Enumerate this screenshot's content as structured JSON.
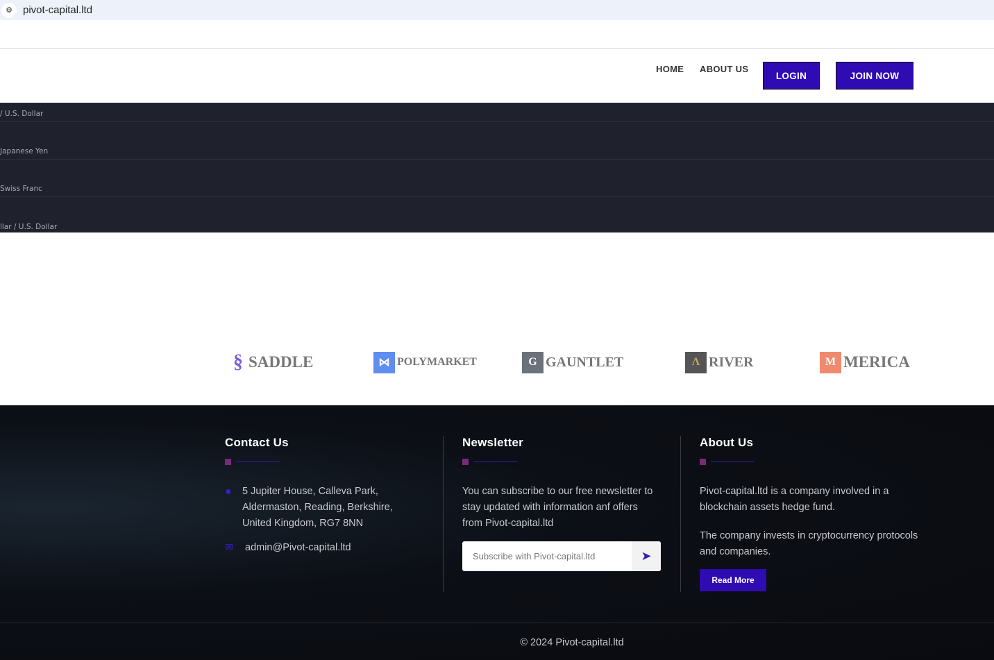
{
  "browser": {
    "url": "pivot-capital.ltd",
    "site_icon": "tune-icon"
  },
  "nav": {
    "home": "HOME",
    "about": "ABOUT US",
    "login": "LOGIN",
    "join": "JOIN NOW"
  },
  "ticker": [
    " / U.S. Dollar",
    "Japanese Yen",
    "Swiss Franc",
    "llar / U.S. Dollar"
  ],
  "partners": [
    "SADDLE",
    "POLYMARKET",
    "GAUNTLET",
    "RIVER",
    "MERICA"
  ],
  "footer": {
    "contact": {
      "title": "Contact Us",
      "address_lines": [
        "5 Jupiter House, Calleva Park,",
        "Aldermaston, Reading, Berkshire,",
        "United Kingdom, RG7 8NN"
      ],
      "email": "admin@Pivot-capital.ltd"
    },
    "newsletter": {
      "title": "Newsletter",
      "text_lines": [
        "You can subscribe to our free newsletter to",
        "stay updated with information anf offers",
        "from Pivot-capital.ltd"
      ],
      "placeholder": "Subscribe with Pivot-capital.ltd"
    },
    "about": {
      "title": "About Us",
      "p1_lines": [
        "Pivot-capital.ltd is a company involved in a",
        "blockchain assets hedge fund."
      ],
      "p2_lines": [
        "The company invests in cryptocurrency protocols",
        "and companies."
      ],
      "read_more": "Read More"
    },
    "copyright": "© 2024 Pivot-capital.ltd"
  },
  "colors": {
    "accent": "#2e0bb3",
    "ticker_bg": "#1f222d"
  }
}
